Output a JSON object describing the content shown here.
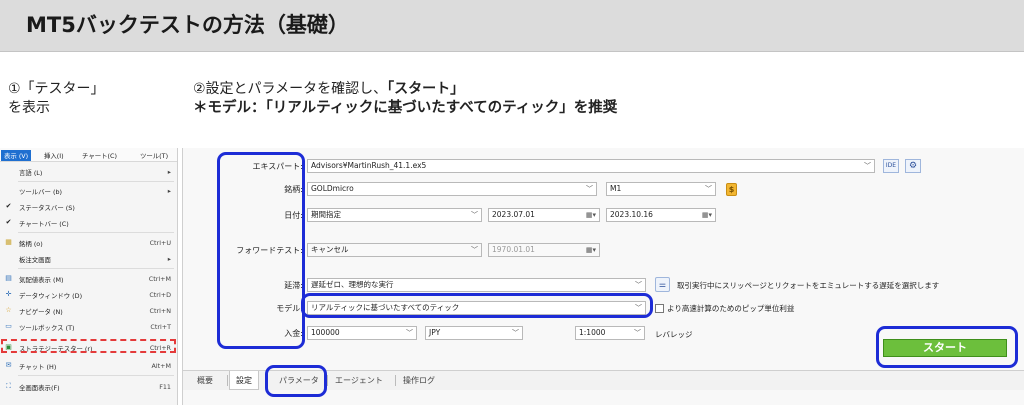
{
  "header": {
    "title": "MT5バックテストの方法（基礎）"
  },
  "instructions": {
    "step1": {
      "line1": "①「テスター」",
      "line2": "を表示"
    },
    "step2": {
      "line1_text": "②設定とパラメータを確認し、",
      "line1_emph": "「スタート」",
      "line2": "＊モデル：「リアルティックに基づいたすべてのティック」を推奨"
    }
  },
  "menu": {
    "bar": [
      "表示 (V)",
      "挿入(I)",
      "チャート(C)",
      "ツール(T)"
    ],
    "items": [
      {
        "label": "言語 (L)",
        "key": "▸",
        "icon": ""
      },
      {
        "label": "ツールバー (b)",
        "key": "▸",
        "icon": ""
      },
      {
        "label": "ステータスバー (S)",
        "key": "",
        "icon": "✔"
      },
      {
        "label": "チャートバー (C)",
        "key": "",
        "icon": "✔"
      },
      {
        "label": "銘柄 (o)",
        "key": "Ctrl+U",
        "icon": "▦"
      },
      {
        "label": "板注文画面",
        "key": "▸",
        "icon": ""
      },
      {
        "label": "気配値表示 (M)",
        "key": "Ctrl+M",
        "icon": "▤"
      },
      {
        "label": "データウィンドウ (D)",
        "key": "Ctrl+D",
        "icon": "✛"
      },
      {
        "label": "ナビゲータ (N)",
        "key": "Ctrl+N",
        "icon": "☆"
      },
      {
        "label": "ツールボックス (T)",
        "key": "Ctrl+T",
        "icon": "▭"
      },
      {
        "label": "ストラテジーテスター (r)",
        "key": "Ctrl+R",
        "icon": "▣"
      },
      {
        "label": "チャット (H)",
        "key": "Alt+M",
        "icon": "✉"
      },
      {
        "label": "全画面表示(F)",
        "key": "F11",
        "icon": "⛶"
      }
    ]
  },
  "tester": {
    "expert": {
      "label": "エキスパート:",
      "value": "Advisors¥MartinRush_41.1.ex5",
      "ide": "IDE"
    },
    "symbol": {
      "label": "銘柄:",
      "value": "GOLDmicro",
      "timeframe": "M1",
      "coin": "$"
    },
    "date": {
      "label": "日付:",
      "mode": "期間指定",
      "from": "2023.07.01",
      "to": "2023.10.16"
    },
    "forward": {
      "label": "フォワードテスト:",
      "value": "キャンセル",
      "date": "1970.01.01"
    },
    "delay": {
      "label": "延滞:",
      "value": "遅延ゼロ、理想的な実行",
      "info": "取引実行中にスリッページとリクォートをエミュレートする遅延を選択します"
    },
    "model": {
      "label": "モデル:",
      "value": "リアルティックに基づいたすべてのティック",
      "checkbox": "より高速計算のためのピップ単位利益"
    },
    "deposit": {
      "label": "入金:",
      "amount": "100000",
      "currency": "JPY",
      "leverage": "1:1000",
      "leverage_label": "レバレッジ"
    },
    "start": "スタート",
    "tabs": [
      "概要",
      "設定",
      "パラメータ",
      "エージェント",
      "操作ログ"
    ]
  },
  "colors": {
    "annotation": "#1d2cd6",
    "menu_highlight": "#e43a3a",
    "start": "#6cbf3c"
  }
}
